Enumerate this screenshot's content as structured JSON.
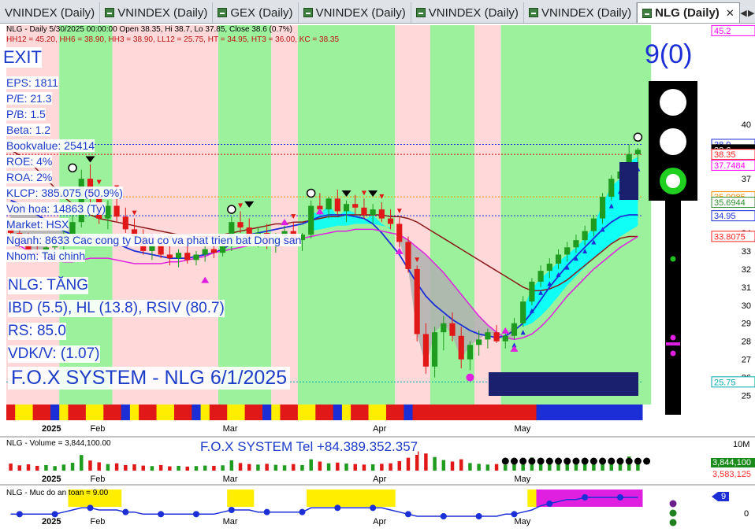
{
  "tabs": [
    {
      "label": "VNINDEX (Daily)",
      "active": false
    },
    {
      "label": "VNINDEX (Daily)",
      "active": false
    },
    {
      "label": "GEX (Daily)",
      "active": false
    },
    {
      "label": "VNINDEX (Daily)",
      "active": false
    },
    {
      "label": "VNINDEX (Daily)",
      "active": false
    },
    {
      "label": "VNINDEX (Daily)",
      "active": false
    },
    {
      "label": "NLG (Daily)",
      "active": true
    }
  ],
  "header": {
    "line1": "NLG - Daily 5/30/2025 00:00:00 Open 38.35, Hi 38.7, Lo 37.85, Close 38.6 (0.7%)",
    "line2": "HH12 = 45.20, HH6 = 38.90, HH3 = 38.90, LL12 = 25.75, HT = 34.95, HT3 = 36.00, KC = 38.35"
  },
  "signal": {
    "exit": "EXIT",
    "count": "9(0)"
  },
  "fundamentals": [
    "EPS: 1811",
    "P/E: 21.3",
    "P/B: 1.5",
    "Beta: 1.2",
    "Bookvalue: 25414",
    "ROE: 4%",
    "ROA: 2%",
    "KLCP: 385.075 (50.9%)",
    "Von hoa: 14863 (Ty)",
    "Market: HSX",
    "Nganh: 8633 Cac cong ty Dau co va phat trien bat Dong san",
    "Nhom: Tai chinh"
  ],
  "status": [
    "NLG: TĂNG",
    "IBD (5.5), HL (13.8), RSIV (80.7)",
    "RS: 85.0",
    "VDK/V:  (1.07)"
  ],
  "watermark": "F.O.X SYSTEM - NLG 6/1/2025",
  "volume_pane": {
    "title": "NLG - Volume = 3,844,100.00",
    "banner": "F.O.X SYSTEM Tel +84.389.352.357",
    "axis_top": "10M",
    "current": "3,844,100",
    "ma": "3,583,125"
  },
  "safety_pane": {
    "title": "NLG - Muc do an toan = 9.00",
    "value_tag": "9",
    "axis_zero": "0"
  },
  "colors": {
    "up": "#1f9c1f",
    "down": "#e01818",
    "bg_green": "#9cf29c",
    "bg_pink": "#ffd9d9",
    "blue_line": "#1c2fd6",
    "brown_line": "#8b1a1a",
    "magenta": "#e020e0",
    "cyan": "#00ffff"
  },
  "chart_data": {
    "type": "candlestick",
    "x_labels": [
      "2025",
      "Feb",
      "Mar",
      "Apr",
      "May"
    ],
    "ylim": [
      24.5,
      45.5
    ],
    "y_ticks": [
      25,
      26,
      27,
      28,
      29,
      30,
      31,
      32,
      33,
      34,
      35,
      36,
      37,
      38,
      39,
      40
    ],
    "price_tags": [
      {
        "value": "45.2",
        "price": 45.2,
        "color": "#ff00ff"
      },
      {
        "value": "38.9",
        "price": 38.9,
        "color": "#ff2020"
      },
      {
        "value": "38.9",
        "price": 38.9,
        "color": "#1c2fd6"
      },
      {
        "value": "38.6",
        "price": 38.6,
        "color": "#000000"
      },
      {
        "value": "38.35",
        "price": 38.35,
        "color": "#ff2020"
      },
      {
        "value": "37.7484",
        "price": 37.7484,
        "color": "#ff00ff"
      },
      {
        "value": "35.9985",
        "price": 35.9985,
        "color": "#ff8c00"
      },
      {
        "value": "35.6944",
        "price": 35.6944,
        "color": "#2e8b2e"
      },
      {
        "value": "34.95",
        "price": 34.95,
        "color": "#1c2fd6"
      },
      {
        "value": "33.8075",
        "price": 33.8075,
        "color": "#ff2020"
      },
      {
        "value": "25.75",
        "price": 25.75,
        "color": "#00aaaa"
      }
    ],
    "candles": [
      [
        34.2,
        34.8,
        33.6,
        34.0
      ],
      [
        34.0,
        34.4,
        33.2,
        33.5
      ],
      [
        33.5,
        34.0,
        32.8,
        33.0
      ],
      [
        33.0,
        33.6,
        32.4,
        32.8
      ],
      [
        32.8,
        33.5,
        32.5,
        33.2
      ],
      [
        33.2,
        33.8,
        32.9,
        33.4
      ],
      [
        33.4,
        34.2,
        33.0,
        33.9
      ],
      [
        33.9,
        35.0,
        33.5,
        34.6
      ],
      [
        34.6,
        37.5,
        34.3,
        37.0
      ],
      [
        37.0,
        37.8,
        35.5,
        36.0
      ],
      [
        36.0,
        36.5,
        34.5,
        34.8
      ],
      [
        34.8,
        35.8,
        34.2,
        35.5
      ],
      [
        35.5,
        36.2,
        34.6,
        34.9
      ],
      [
        34.9,
        35.4,
        34.0,
        34.2
      ],
      [
        34.2,
        34.8,
        33.4,
        33.8
      ],
      [
        33.8,
        34.2,
        32.8,
        33.0
      ],
      [
        33.0,
        33.8,
        32.5,
        33.4
      ],
      [
        33.4,
        33.9,
        32.6,
        32.8
      ],
      [
        32.8,
        33.4,
        32.2,
        32.6
      ],
      [
        32.6,
        33.1,
        32.1,
        32.9
      ],
      [
        32.9,
        33.3,
        32.3,
        32.5
      ],
      [
        32.5,
        33.0,
        32.2,
        32.8
      ],
      [
        32.8,
        33.3,
        32.4,
        33.1
      ],
      [
        33.1,
        33.6,
        32.6,
        32.9
      ],
      [
        32.9,
        33.5,
        32.7,
        33.3
      ],
      [
        33.3,
        34.9,
        33.0,
        34.6
      ],
      [
        34.6,
        35.2,
        34.0,
        34.3
      ],
      [
        34.3,
        34.8,
        33.4,
        33.7
      ],
      [
        33.7,
        34.3,
        33.2,
        34.0
      ],
      [
        34.0,
        34.5,
        33.1,
        33.4
      ],
      [
        33.4,
        34.0,
        32.9,
        33.8
      ],
      [
        33.8,
        34.4,
        33.3,
        34.1
      ],
      [
        34.1,
        34.6,
        33.5,
        33.6
      ],
      [
        33.6,
        34.0,
        33.0,
        33.9
      ],
      [
        33.9,
        35.8,
        33.7,
        35.5
      ],
      [
        35.5,
        36.2,
        35.0,
        35.3
      ],
      [
        35.3,
        36.0,
        34.8,
        35.9
      ],
      [
        35.9,
        36.4,
        35.0,
        35.2
      ],
      [
        35.2,
        35.8,
        34.6,
        35.6
      ],
      [
        35.6,
        36.1,
        35.0,
        35.4
      ],
      [
        35.4,
        35.9,
        34.8,
        35.0
      ],
      [
        35.0,
        35.6,
        34.5,
        35.3
      ],
      [
        35.3,
        35.7,
        34.6,
        34.8
      ],
      [
        34.8,
        35.3,
        34.2,
        34.5
      ],
      [
        34.5,
        34.9,
        33.2,
        33.5
      ],
      [
        33.5,
        33.8,
        31.8,
        32.0
      ],
      [
        32.0,
        32.2,
        28.0,
        28.4
      ],
      [
        28.4,
        29.0,
        26.2,
        26.6
      ],
      [
        26.6,
        28.8,
        26.0,
        28.5
      ],
      [
        28.5,
        29.4,
        27.5,
        29.0
      ],
      [
        29.0,
        29.6,
        28.0,
        28.3
      ],
      [
        28.3,
        28.8,
        26.5,
        27.0
      ],
      [
        27.0,
        28.0,
        26.4,
        27.8
      ],
      [
        27.8,
        28.6,
        27.2,
        28.1
      ],
      [
        28.1,
        28.7,
        27.6,
        28.5
      ],
      [
        28.5,
        28.9,
        27.9,
        28.0
      ],
      [
        28.0,
        28.5,
        27.6,
        28.3
      ],
      [
        28.3,
        29.3,
        28.1,
        29.0
      ],
      [
        29.0,
        30.5,
        28.8,
        30.2
      ],
      [
        30.2,
        31.5,
        30.0,
        31.3
      ],
      [
        31.3,
        32.2,
        31.0,
        31.9
      ],
      [
        31.9,
        32.6,
        31.5,
        32.3
      ],
      [
        32.3,
        33.1,
        32.0,
        32.8
      ],
      [
        32.8,
        33.5,
        32.4,
        33.2
      ],
      [
        33.2,
        33.9,
        32.9,
        33.6
      ],
      [
        33.6,
        34.4,
        33.3,
        34.1
      ],
      [
        34.1,
        35.0,
        33.8,
        34.8
      ],
      [
        34.8,
        36.2,
        34.5,
        36.0
      ],
      [
        36.0,
        37.2,
        35.8,
        37.0
      ],
      [
        37.0,
        37.8,
        36.6,
        37.4
      ],
      [
        37.4,
        38.9,
        37.2,
        38.35
      ],
      [
        38.35,
        38.7,
        37.85,
        38.6
      ]
    ],
    "ma_brown": [
      38.6,
      38.3,
      38.0,
      37.5,
      37.0,
      36.5,
      36.0,
      35.6,
      35.3,
      35.0,
      34.8,
      34.7,
      34.6,
      34.5,
      34.4,
      34.3,
      34.2,
      34.1,
      34.0,
      33.9,
      33.9,
      33.8,
      33.8,
      33.8,
      33.9,
      34.0,
      34.1,
      34.2,
      34.3,
      34.4,
      34.5,
      34.5,
      34.6,
      34.6,
      34.7,
      34.8,
      34.9,
      34.9,
      35.0,
      35.0,
      35.0,
      35.0,
      35.0,
      34.9,
      34.9,
      34.8,
      34.6,
      34.3,
      34.0,
      33.7,
      33.4,
      33.1,
      32.8,
      32.5,
      32.2,
      31.9,
      31.6,
      31.3,
      31.0,
      30.8,
      30.8,
      30.9,
      31.1,
      31.4,
      31.8,
      32.2,
      32.6,
      33.0,
      33.4,
      33.7,
      33.8,
      33.8
    ],
    "ma_blue": [
      35.8,
      35.6,
      35.3,
      35.0,
      34.7,
      34.4,
      34.1,
      33.9,
      33.8,
      33.7,
      33.6,
      33.5,
      33.4,
      33.2,
      33.0,
      32.9,
      32.8,
      32.7,
      32.6,
      32.6,
      32.6,
      32.7,
      32.8,
      32.9,
      33.1,
      33.4,
      33.7,
      33.9,
      34.0,
      34.1,
      34.2,
      34.3,
      34.4,
      34.5,
      34.7,
      34.9,
      35.0,
      35.0,
      35.0,
      34.9,
      34.8,
      34.5,
      34.0,
      33.4,
      32.8,
      32.0,
      31.2,
      30.5,
      30.0,
      29.6,
      29.2,
      28.9,
      28.6,
      28.4,
      28.3,
      28.2,
      28.3,
      28.6,
      29.0,
      29.6,
      30.3,
      31.0,
      31.6,
      32.2,
      32.7,
      33.2,
      33.7,
      34.2,
      34.6,
      34.9,
      35.0,
      35.0
    ],
    "ma_magenta": [
      33.5,
      33.3,
      33.0,
      32.8,
      32.6,
      32.5,
      32.4,
      32.4,
      32.5,
      32.6,
      32.6,
      32.6,
      32.5,
      32.4,
      32.3,
      32.3,
      32.3,
      32.3,
      32.4,
      32.4,
      32.5,
      32.6,
      32.7,
      32.9,
      33.0,
      33.1,
      33.2,
      33.3,
      33.3,
      33.4,
      33.5,
      33.5,
      33.6,
      33.7,
      33.8,
      33.9,
      34.0,
      34.1,
      34.1,
      34.2,
      34.2,
      34.2,
      34.1,
      34.0,
      33.9,
      33.6,
      33.2,
      32.8,
      32.3,
      31.8,
      31.2,
      30.6,
      30.0,
      29.4,
      28.9,
      28.5,
      28.2,
      28.1,
      28.2,
      28.4,
      28.8,
      29.3,
      29.9,
      30.5,
      31.0,
      31.5,
      32.0,
      32.4,
      32.8,
      33.2,
      33.5,
      33.8
    ],
    "background_bands": [
      {
        "from": 0,
        "to": 6,
        "color": "pink"
      },
      {
        "from": 6,
        "to": 12,
        "color": "green"
      },
      {
        "from": 12,
        "to": 24,
        "color": "pink"
      },
      {
        "from": 24,
        "to": 30,
        "color": "green"
      },
      {
        "from": 30,
        "to": 33,
        "color": "pink"
      },
      {
        "from": 33,
        "to": 44,
        "color": "green"
      },
      {
        "from": 44,
        "to": 48,
        "color": "pink"
      },
      {
        "from": 48,
        "to": 53,
        "color": "green"
      },
      {
        "from": 53,
        "to": 56,
        "color": "pink"
      },
      {
        "from": 56,
        "to": 60,
        "color": "green"
      },
      {
        "from": 60,
        "to": 73,
        "color": "green"
      }
    ],
    "volume": [
      2.8,
      2.1,
      2.5,
      1.9,
      2.2,
      1.8,
      2.4,
      3.1,
      6.2,
      4.0,
      3.3,
      2.6,
      2.9,
      2.2,
      2.5,
      2.0,
      1.8,
      2.2,
      1.7,
      1.9,
      1.6,
      1.8,
      2.0,
      1.9,
      2.1,
      4.1,
      3.0,
      2.6,
      2.4,
      2.7,
      2.3,
      2.1,
      2.6,
      2.2,
      4.5,
      3.6,
      2.9,
      3.2,
      2.8,
      2.6,
      2.4,
      2.5,
      2.7,
      2.9,
      3.8,
      5.1,
      7.6,
      6.8,
      5.4,
      4.2,
      3.6,
      4.5,
      3.0,
      2.7,
      2.4,
      2.6,
      2.3,
      2.9,
      4.0,
      5.2,
      4.1,
      3.8,
      3.6,
      3.9,
      3.4,
      3.7,
      3.9,
      4.4,
      5.0,
      4.6,
      5.6,
      3.8
    ],
    "safety": [
      1,
      1,
      1,
      1,
      1,
      1,
      2,
      3,
      4,
      4,
      3,
      3,
      3,
      2,
      2,
      1,
      1,
      1,
      1,
      1,
      1,
      1,
      1,
      1,
      2,
      3,
      3,
      3,
      2,
      2,
      2,
      2,
      2,
      2,
      4,
      4,
      4,
      4,
      4,
      4,
      4,
      4,
      4,
      3,
      2,
      1,
      0,
      0,
      0,
      0,
      0,
      0,
      0,
      0,
      0,
      0,
      1,
      1,
      2,
      3,
      5,
      6,
      7,
      8,
      8,
      9,
      9,
      9,
      9,
      9,
      9,
      9
    ]
  }
}
